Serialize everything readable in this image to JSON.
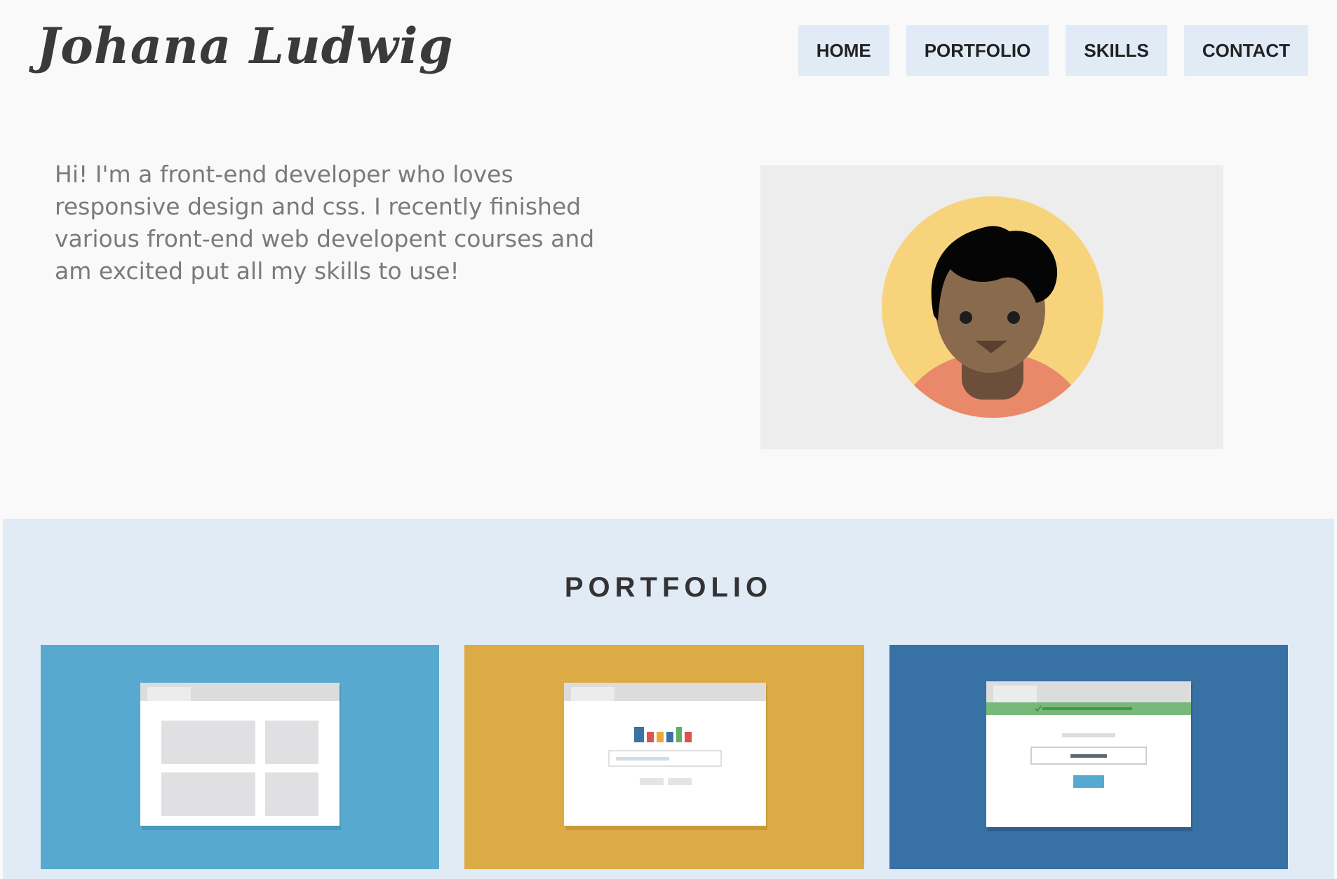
{
  "header": {
    "logo": "Johana Ludwig"
  },
  "nav": {
    "items": [
      "HOME",
      "PORTFOLIO",
      "SKILLS",
      "CONTACT"
    ]
  },
  "intro": {
    "text": "Hi! I'm a front-end developer who loves responsive design and css. I recently finished various front-end web developent courses and am excited put all my skills to use!"
  },
  "portfolio": {
    "title": "PORTFOLIO",
    "cards": [
      {
        "name": "layout-project",
        "color": "#58a9cf"
      },
      {
        "name": "chart-project",
        "color": "#dcab45"
      },
      {
        "name": "form-project",
        "color": "#3871a3"
      }
    ]
  },
  "colors": {
    "background": "#f9f9f9",
    "nav_bg": "#e0ebf6",
    "portfolio_bg": "#e1ebf6",
    "avatar_circle": "#f7d47c",
    "skin": "#8a6a4d",
    "shirt": "#e9896a"
  }
}
